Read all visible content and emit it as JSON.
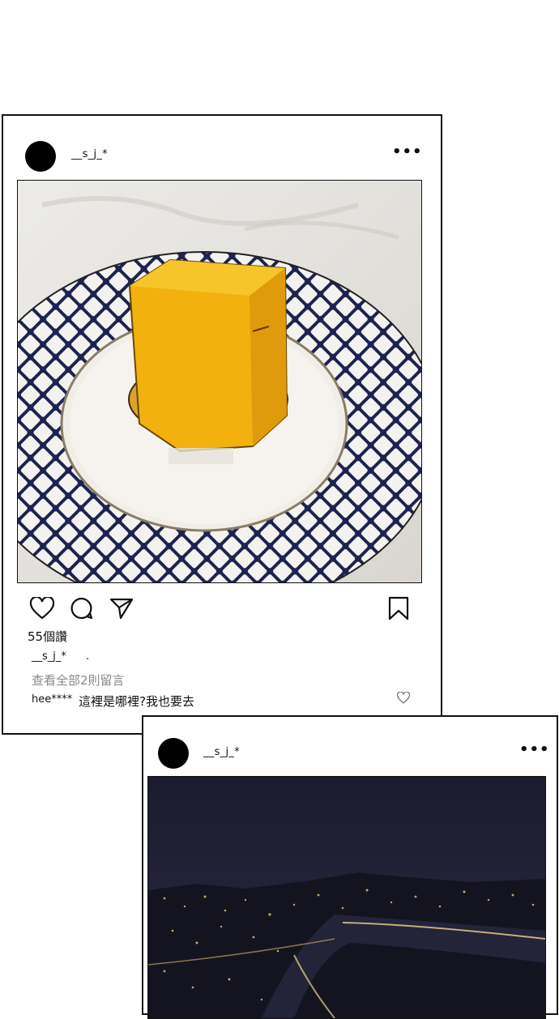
{
  "post1": {
    "username": "__s_j_*",
    "more_icon": "more-horizontal-icon",
    "more_glyph": "•••",
    "photo_desc": "mango-mousse-cube-on-patterned-plate",
    "actions": [
      "heart-icon",
      "comment-icon",
      "send-icon",
      "bookmark-icon"
    ],
    "likes": "55個讚",
    "caption_user": "__s_j_*",
    "caption_text": ".",
    "view_comments": "查看全部2則留言",
    "comment": {
      "user": "hee****",
      "text": "這裡是哪裡?我也要去",
      "icon": "small-heart-icon"
    }
  },
  "post2": {
    "username": "__s_j_*",
    "more_icon": "more-horizontal-icon",
    "more_glyph": "•••",
    "photo_desc": "night-city-skyline-with-river"
  },
  "colors": {
    "border": "#111111",
    "muted_text": "#888888",
    "background": "#ffffff",
    "cake": "#f2b10f",
    "plate_pattern": "#1d2350",
    "night_sky": "#1b1b2b",
    "city_lights": "#e8c070"
  }
}
